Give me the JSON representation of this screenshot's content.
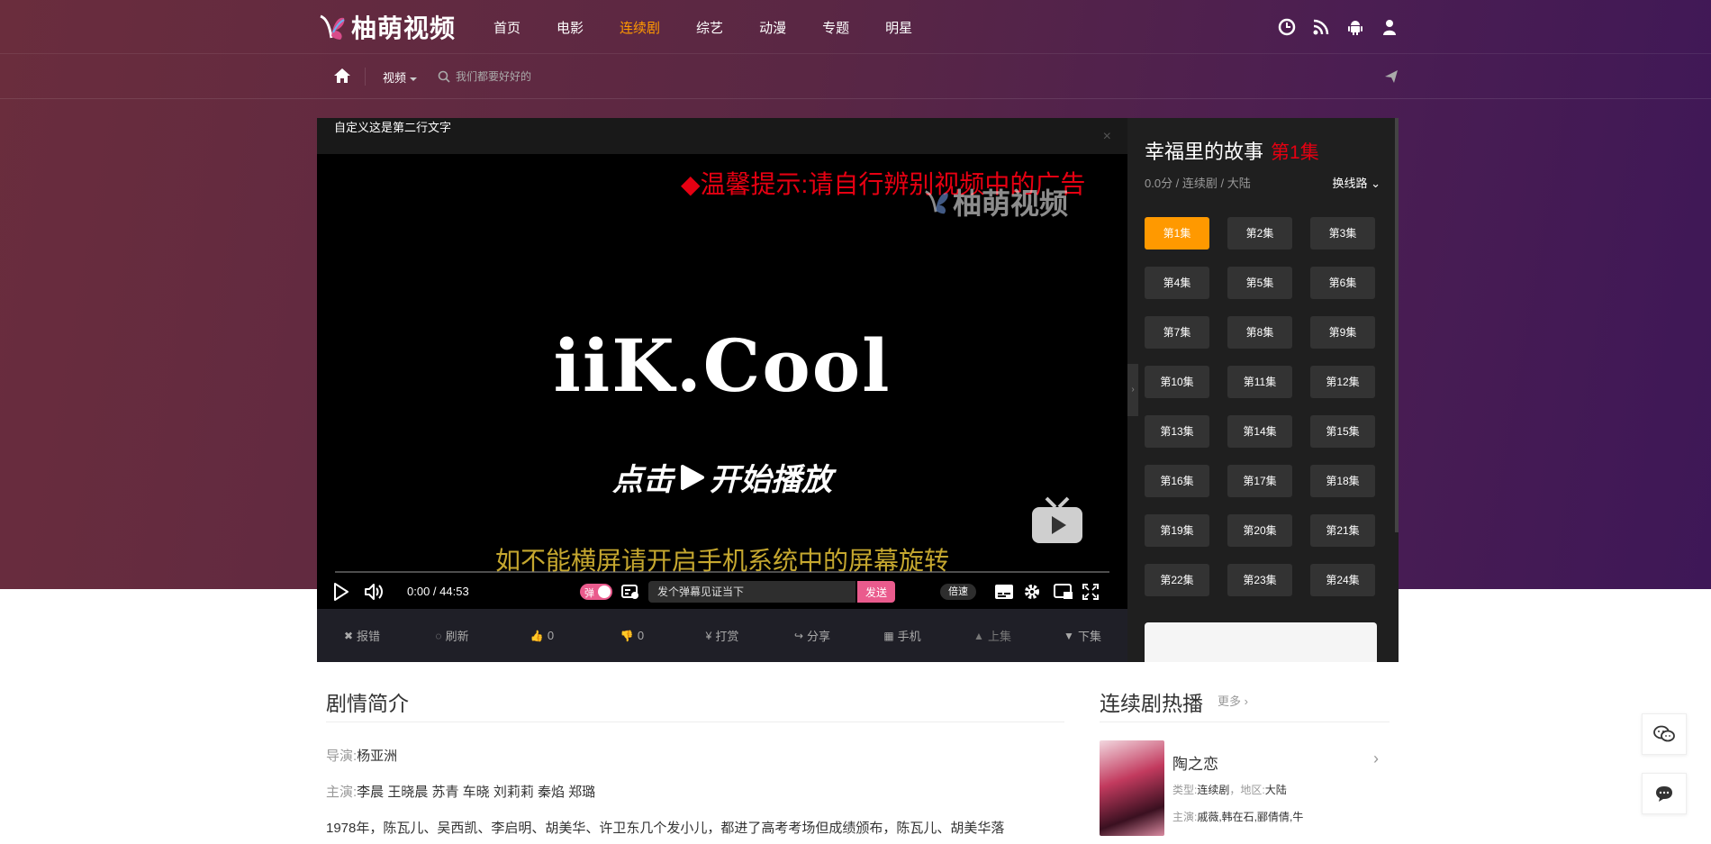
{
  "header": {
    "logo_text": "柚萌视频",
    "nav": [
      "首页",
      "电影",
      "连续剧",
      "综艺",
      "动漫",
      "专题",
      "明星"
    ],
    "active_index": 2,
    "icons": [
      "history-icon",
      "rss-icon",
      "android-icon",
      "user-icon"
    ]
  },
  "subnav": {
    "category": "视频",
    "search_placeholder": "我们都要好好的"
  },
  "player": {
    "top_text": "自定义这是第二行文字",
    "close": "×",
    "warning": "◆温馨提示:请自行辨别视频中的广告",
    "watermark": "柚萌视频",
    "brand": "iiK.Cool",
    "start_left": "点击",
    "start_right": "开始播放",
    "rotate_tip": "如不能横屏请开启手机系统中的屏幕旋转",
    "time": "0:00 / 44:53",
    "danmu_label": "弹",
    "danmu_placeholder": "发个弹幕见证当下",
    "send_label": "发送",
    "speed_label": "倍速"
  },
  "actions": [
    {
      "icon": "✖",
      "label": "报错",
      "name": "report-error"
    },
    {
      "icon": "◌",
      "label": "刷新",
      "name": "refresh"
    },
    {
      "icon": "👍",
      "label": "0",
      "name": "like"
    },
    {
      "icon": "👎",
      "label": "0",
      "name": "dislike"
    },
    {
      "icon": "¥",
      "label": "打赏",
      "name": "reward"
    },
    {
      "icon": "↪",
      "label": "分享",
      "name": "share"
    },
    {
      "icon": "▦",
      "label": "手机",
      "name": "mobile"
    },
    {
      "icon": "▲",
      "label": "上集",
      "name": "prev-episode"
    },
    {
      "icon": "▼",
      "label": "下集",
      "name": "next-episode"
    }
  ],
  "side": {
    "title": "幸福里的故事",
    "current_ep": "第1集",
    "meta": "0.0分 / 连续剧 / 大陆",
    "switch_label": "换线路",
    "episodes": [
      "第1集",
      "第2集",
      "第3集",
      "第4集",
      "第5集",
      "第6集",
      "第7集",
      "第8集",
      "第9集",
      "第10集",
      "第11集",
      "第12集",
      "第13集",
      "第14集",
      "第15集",
      "第16集",
      "第17集",
      "第18集",
      "第19集",
      "第20集",
      "第21集",
      "第22集",
      "第23集",
      "第24集"
    ],
    "active_episode": 0
  },
  "intro": {
    "title": "剧情简介",
    "director_key": "导演:",
    "director": "杨亚洲",
    "cast_key": "主演:",
    "cast": "李晨 王晓晨 苏青 车晓 刘莉莉 秦焰 郑璐",
    "desc": "1978年，陈瓦儿、吴西凯、李启明、胡美华、许卫东几个发小儿，都进了高考考场但成绩颁布，陈瓦儿、胡美华落"
  },
  "hot": {
    "title": "连续剧热播",
    "more": "更多",
    "item": {
      "name": "陶之恋",
      "type_key": "类型:",
      "type": "连续剧",
      "area_key": "地区:",
      "area": "大陆",
      "cast_key": "主演:",
      "cast": "戚薇,韩在石,郦倩倩,牛"
    }
  }
}
